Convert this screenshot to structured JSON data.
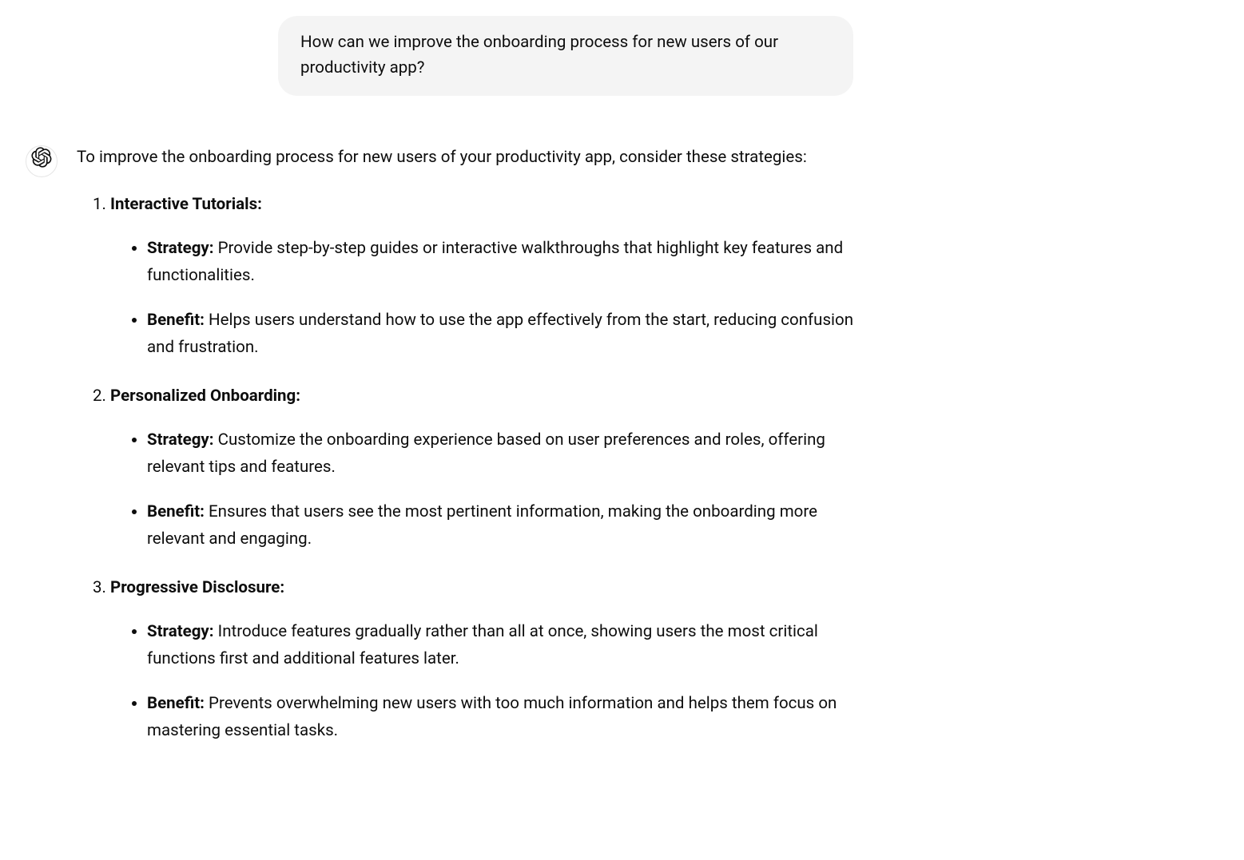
{
  "user_message": "How can we improve the onboarding process for new users of our productivity app?",
  "assistant": {
    "intro": "To improve the onboarding process for new users of your productivity app, consider these strategies:",
    "labels": {
      "strategy": "Strategy:",
      "benefit": "Benefit:"
    },
    "items": [
      {
        "title": "Interactive Tutorials:",
        "strategy": "Provide step-by-step guides or interactive walkthroughs that highlight key features and functionalities.",
        "benefit": "Helps users understand how to use the app effectively from the start, reducing confusion and frustration."
      },
      {
        "title": "Personalized Onboarding:",
        "strategy": "Customize the onboarding experience based on user preferences and roles, offering relevant tips and features.",
        "benefit": "Ensures that users see the most pertinent information, making the onboarding more relevant and engaging."
      },
      {
        "title": "Progressive Disclosure:",
        "strategy": "Introduce features gradually rather than all at once, showing users the most critical functions first and additional features later.",
        "benefit": "Prevents overwhelming new users with too much information and helps them focus on mastering essential tasks."
      }
    ]
  }
}
